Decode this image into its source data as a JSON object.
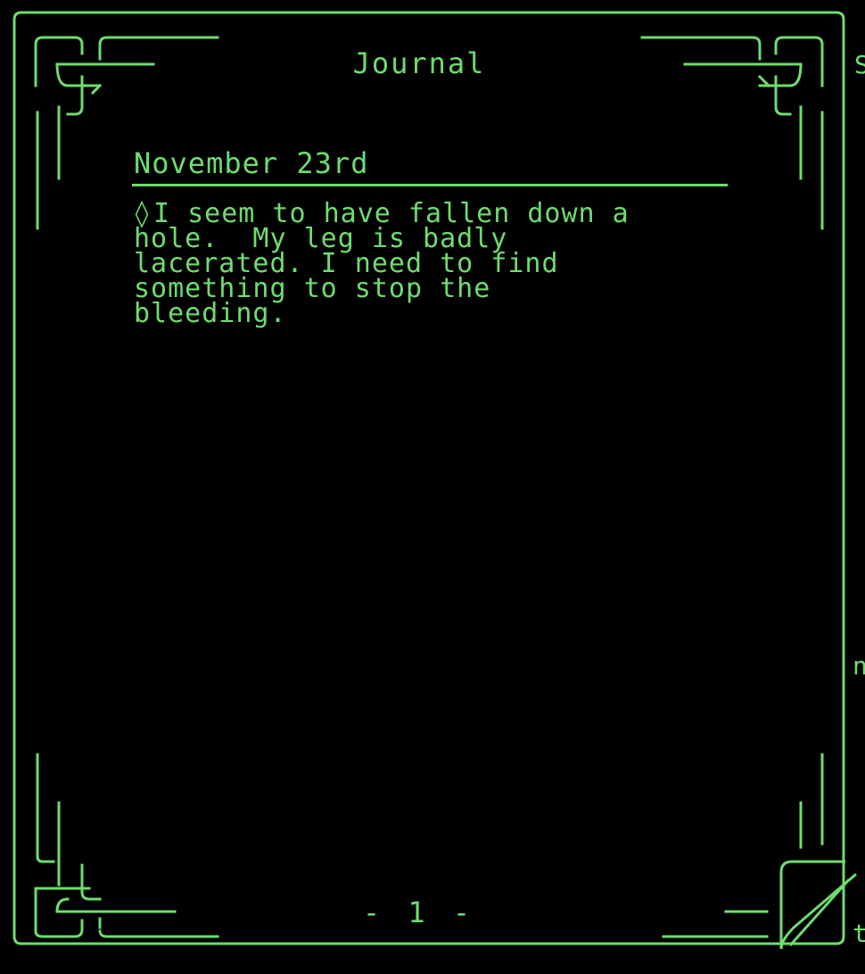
{
  "journal": {
    "title": "Journal",
    "entry": {
      "bullet": "◊",
      "date": "November 23rd",
      "text": "I seem to have fallen down a\nhole.  My leg is badly\nlacerated. I need to find\nsomething to stop the\nbleeding."
    },
    "page_label": "- 1 -"
  },
  "background_fragments": {
    "right_top": "S",
    "right_mid": "n",
    "right_bottom": "t"
  },
  "colors": {
    "phosphor_green": "#6fdc6f",
    "background": "#000000"
  }
}
